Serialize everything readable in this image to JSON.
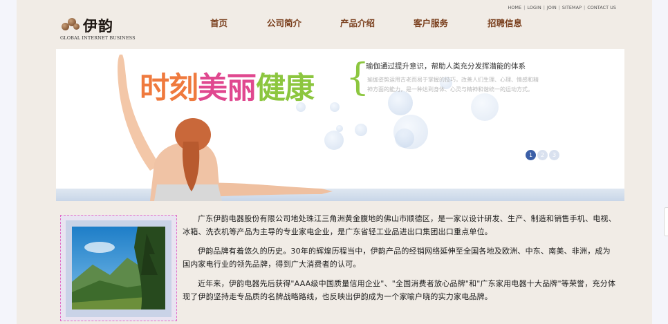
{
  "header": {
    "logo_name": "伊韵",
    "logo_subtitle": "GLOBAL INTERNET BUSINESS",
    "utility_links": [
      "HOME",
      "LOGIN",
      "JOIN",
      "SITEMAP",
      "CONTACT US"
    ],
    "nav": [
      "首页",
      "公司简介",
      "产品介绍",
      "客户服务",
      "招聘信息"
    ]
  },
  "banner": {
    "headline_part1": "时刻",
    "headline_part2": "美丽",
    "headline_part3": "健康",
    "brace": "{",
    "tagline": "瑜伽通过提升意识，帮助人类充分发挥潜能的体系",
    "description": "瑜伽姿势运用古老而易于掌握的技巧，改善人们生理、心理、情感和精神方面的能力，是一种达到身体、心灵与精神和谐统一的运动方式。",
    "slide_indicators": [
      "1",
      "2",
      "3"
    ],
    "active_slide": 1
  },
  "content": {
    "paragraphs": [
      "广东伊韵电器股份有限公司地处珠江三角洲黄金腹地的佛山市顺德区，是一家以设计研发、生产、制造和销售手机、电视、冰箱、洗衣机等产品为主导的专业家电企业，是广东省轻工业品进出口集团出口重点单位。",
      "伊韵品牌有着悠久的历史。30年的辉煌历程当中，伊韵产品的经销网络延伸至全国各地及欧洲、中东、南美、非洲，成为国内家电行业的领先品牌，得到广大消费者的认可。",
      "近年来，伊韵电器先后获得\"AAA级中国质量信用企业\"、\"全国消费者放心品牌\"和\"广东家用电器十大品牌\"等荣誉，充分体现了伊韵坚持走专品质的名牌战略路线，也反映出伊韵成为一个家喻户晓的实力家电品牌。"
    ]
  },
  "colors": {
    "page_bg": "#f1ece6",
    "nav_text": "#7a3f1d",
    "headline_orange": "#ef7a3e",
    "headline_pink": "#e0488f",
    "headline_green": "#8cc63f",
    "active_dot": "#3b5fa7"
  }
}
